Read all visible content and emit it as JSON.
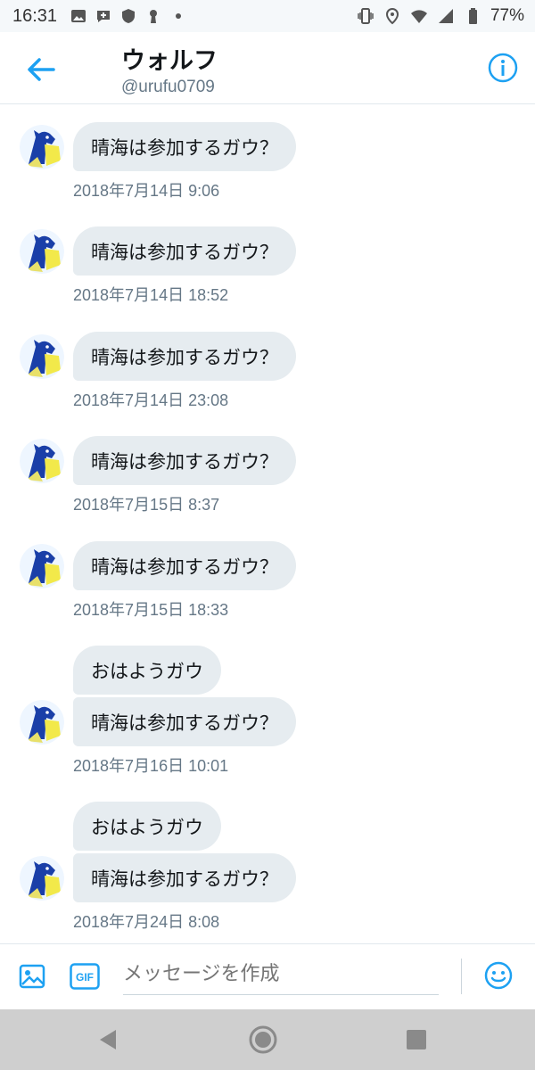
{
  "status_bar": {
    "time": "16:31",
    "battery": "77%",
    "icons_left": [
      "image-icon",
      "chat-plus-icon",
      "shield-icon",
      "keyhole-icon",
      "dot-icon"
    ],
    "icons_right": [
      "vibrate-icon",
      "location-icon",
      "wifi-icon",
      "signal-icon",
      "battery-icon"
    ]
  },
  "header": {
    "name": "ウォルフ",
    "handle": "@urufu0709",
    "accent": "#1da1f2"
  },
  "messages": [
    {
      "bubbles": [
        "晴海は参加するガウ？"
      ],
      "timestamp": "2018年7月14日 9:06"
    },
    {
      "bubbles": [
        "晴海は参加するガウ？"
      ],
      "timestamp": "2018年7月14日 18:52"
    },
    {
      "bubbles": [
        "晴海は参加するガウ？"
      ],
      "timestamp": "2018年7月14日 23:08"
    },
    {
      "bubbles": [
        "晴海は参加するガウ？"
      ],
      "timestamp": "2018年7月15日 8:37"
    },
    {
      "bubbles": [
        "晴海は参加するガウ？"
      ],
      "timestamp": "2018年7月15日 18:33"
    },
    {
      "bubbles": [
        "おはようガウ",
        "晴海は参加するガウ？"
      ],
      "timestamp": "2018年7月16日 10:01"
    },
    {
      "bubbles": [
        "おはようガウ",
        "晴海は参加するガウ？"
      ],
      "timestamp": "2018年7月24日 8:08"
    }
  ],
  "composer": {
    "placeholder": "メッセージを作成",
    "gif_label": "GIF"
  },
  "nav": {
    "buttons": [
      "back-icon",
      "home-icon",
      "recents-icon"
    ]
  },
  "colors": {
    "bubble_bg": "#e6ecf0",
    "timestamp": "#657786",
    "accent": "#1da1f2"
  }
}
